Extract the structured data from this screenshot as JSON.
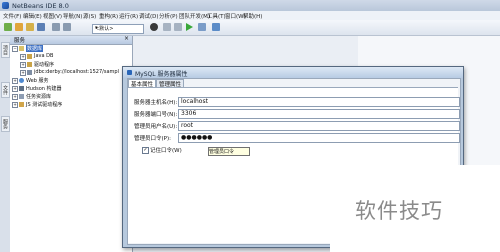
{
  "window": {
    "title": "NetBeans IDE 8.0"
  },
  "menu": [
    "文件(F)",
    "编辑(E)",
    "视图(V)",
    "导航(N)",
    "源(S)",
    "重构(R)",
    "运行(R)",
    "调试(D)",
    "分析(P)",
    "团队开发(M)",
    "工具(T)",
    "窗口(W)",
    "帮助(H)"
  ],
  "toolbar": {
    "config_value": "<默认>"
  },
  "left_strip": {
    "tabs": [
      "项目",
      "文件",
      "服务"
    ]
  },
  "services_panel": {
    "title": "服务",
    "close": "×",
    "tree": [
      {
        "label": "数据库",
        "level": 0,
        "expanded": true,
        "selected": true
      },
      {
        "label": "Java DB",
        "level": 1,
        "expanded": false
      },
      {
        "label": "驱动程序",
        "level": 1,
        "expanded": false
      },
      {
        "label": "jdbc:derby://localhost:1527/sampl",
        "level": 1,
        "expanded": false
      },
      {
        "label": "Web 服务",
        "level": 0,
        "expanded": false
      },
      {
        "label": "Hudson 构建器",
        "level": 0,
        "expanded": false
      },
      {
        "label": "任务资源库",
        "level": 0,
        "expanded": false
      },
      {
        "label": "JS 测试驱动程序",
        "level": 0,
        "expanded": false
      }
    ]
  },
  "dialog": {
    "title": "MySQL 服务器属性",
    "tabs": [
      "基本属性",
      "管理属性"
    ],
    "active_tab": 0,
    "fields": [
      {
        "label": "服务器主机名(H):",
        "value": "localhost"
      },
      {
        "label": "服务器端口号(N):",
        "value": "3306"
      },
      {
        "label": "管理员用户名(U):",
        "value": "root"
      },
      {
        "label": "管理员口令(P):",
        "value": "●●●●●●"
      }
    ],
    "remember_password": {
      "label": "记住口令(W)",
      "checked": true
    },
    "tooltip": "管理员口令"
  },
  "watermark": "软件技巧"
}
